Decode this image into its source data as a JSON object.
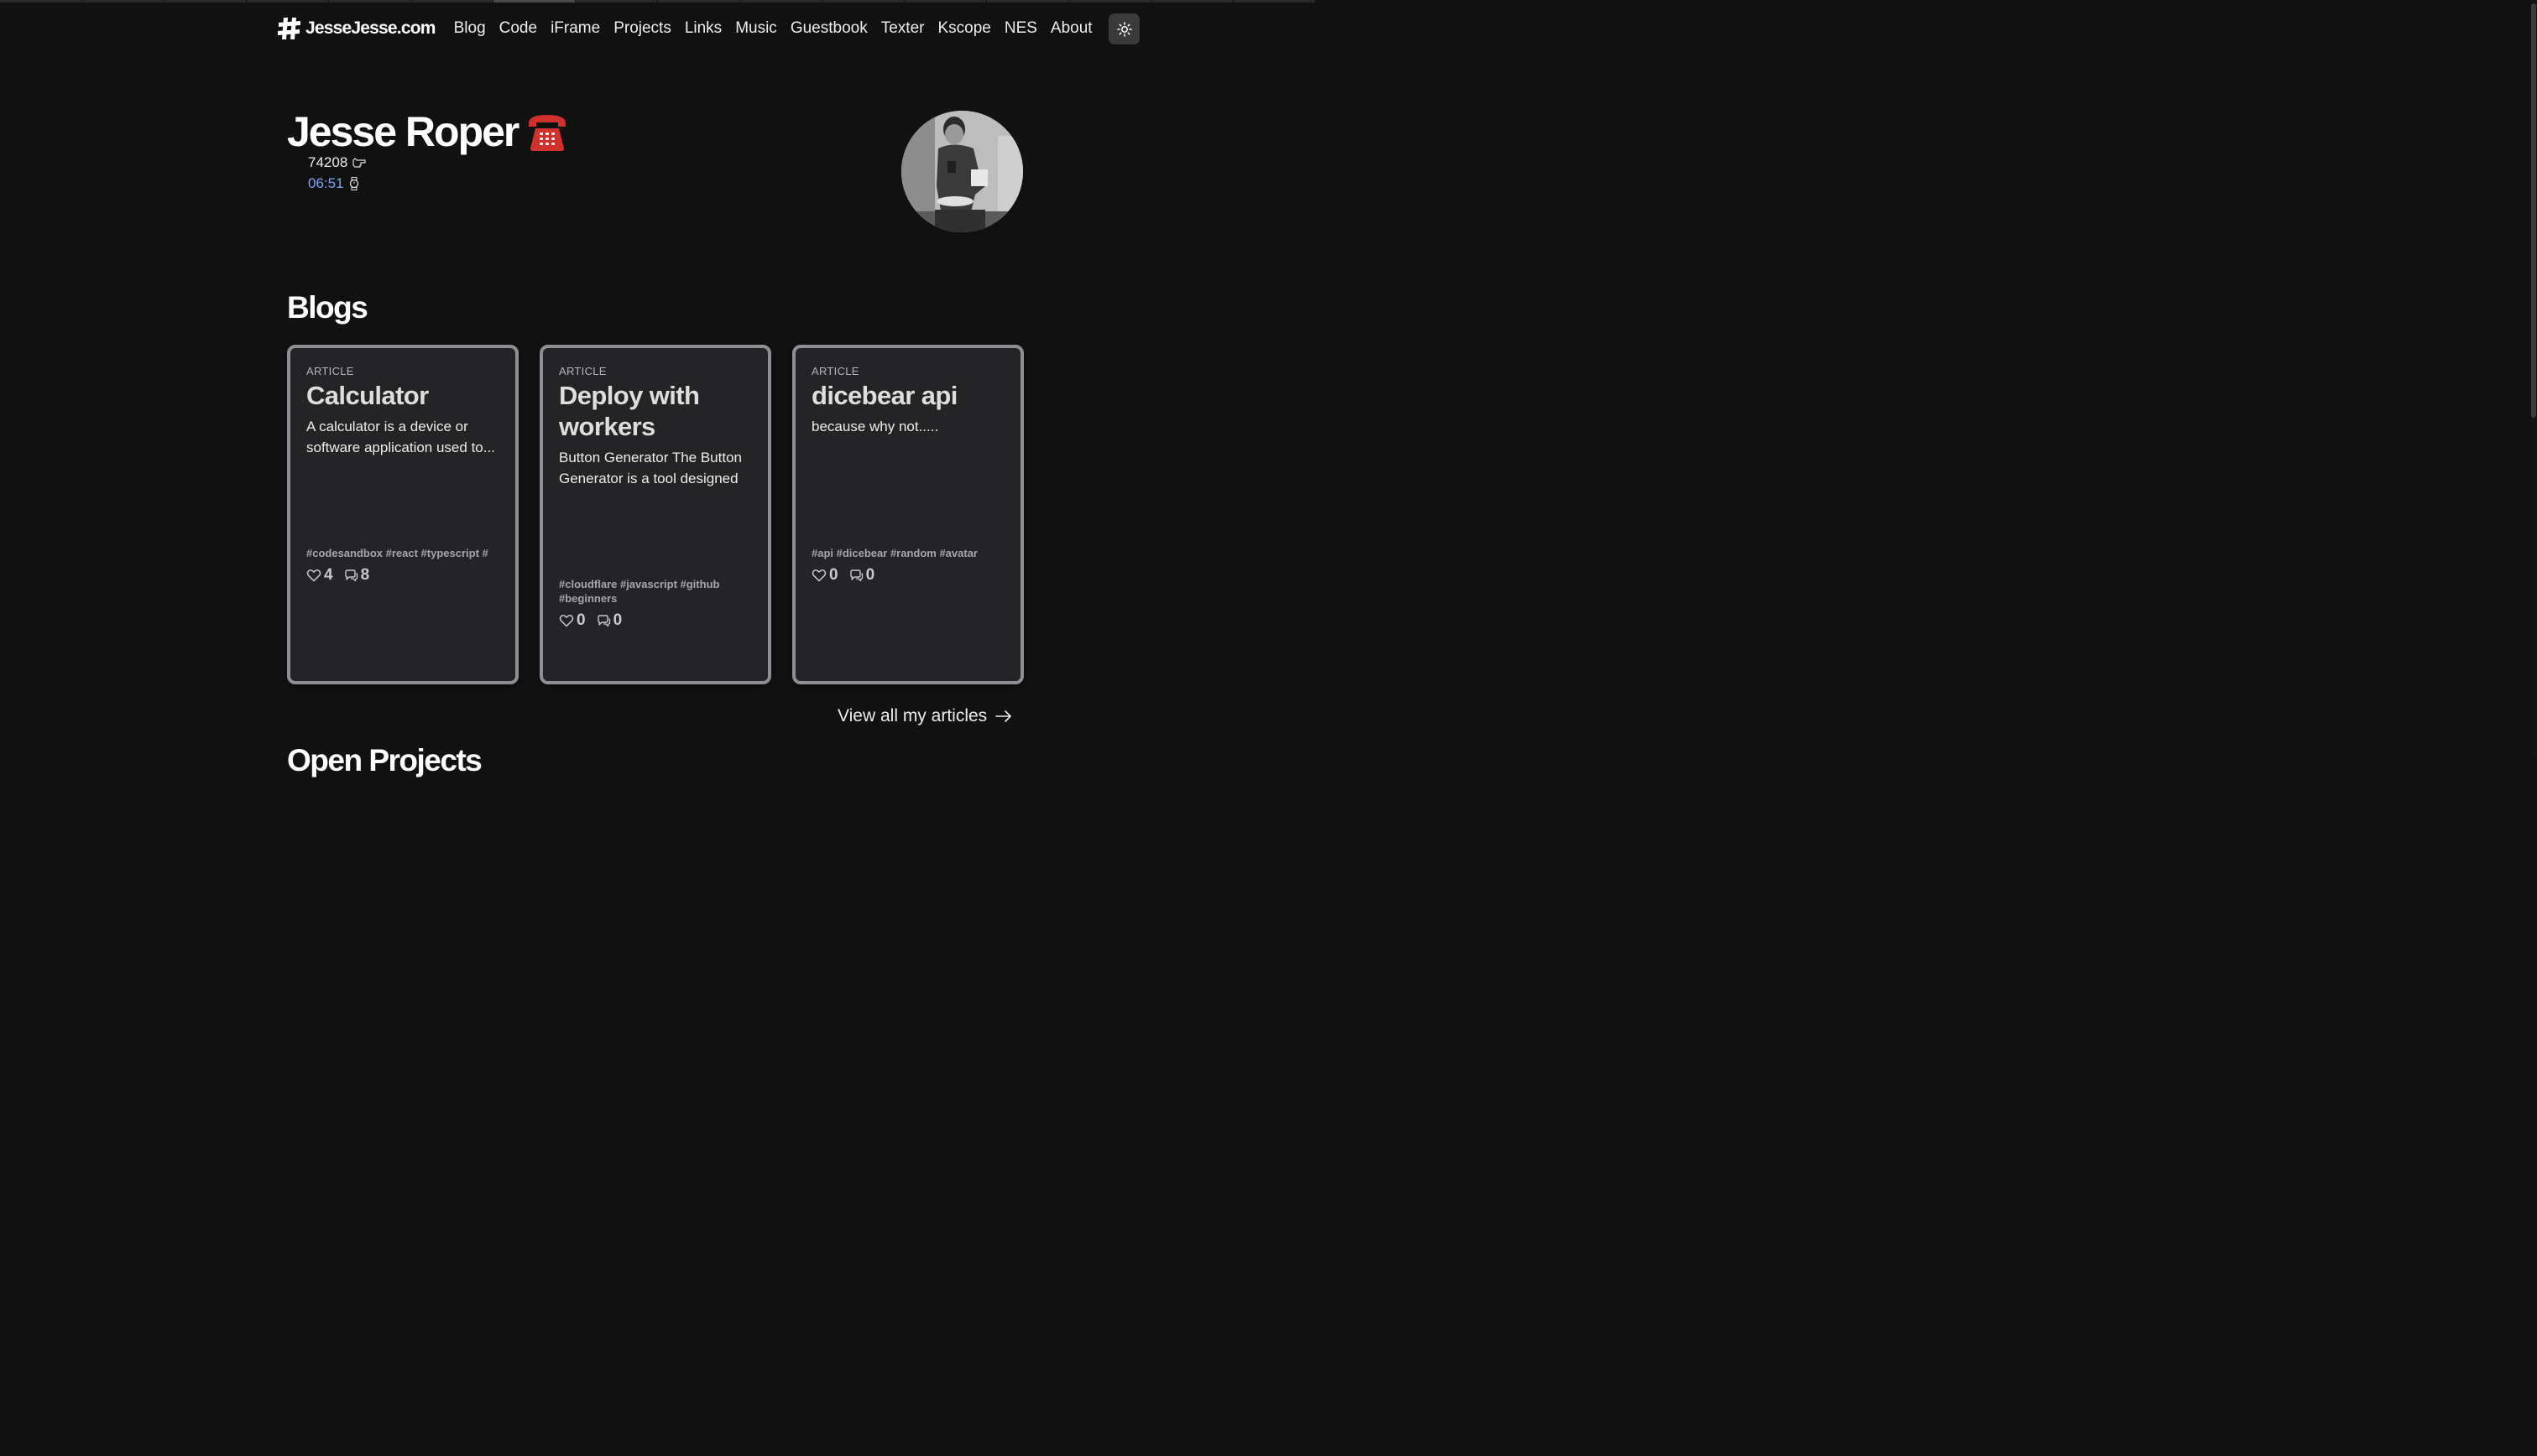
{
  "header": {
    "logo_text": "JesseJesse.com",
    "nav_links": [
      "Blog",
      "Code",
      "iFrame",
      "Projects",
      "Links",
      "Music",
      "Guestbook",
      "Texter",
      "Kscope",
      "NES",
      "About"
    ],
    "theme_toggle_icon": "sun-icon"
  },
  "hero": {
    "name": "Jesse Roper",
    "name_emoji_icon": "telephone-icon",
    "visit_count": "74208",
    "visit_icon": "pointing-hand-icon",
    "local_time": "06:51",
    "time_icon": "watch-icon",
    "avatar_icon": "profile-photo"
  },
  "blogs": {
    "title": "Blogs",
    "cards": [
      {
        "type": "ARTICLE",
        "title": "Calculator",
        "description": "A calculator is a device or software application used to...",
        "tags": "#codesandbox #react #typescript #",
        "likes": "4",
        "comments": "8"
      },
      {
        "type": "ARTICLE",
        "title": "Deploy with workers",
        "description": "Button Generator The Button Generator is a tool designed ...",
        "tags": "#cloudflare #javascript #github #beginners",
        "likes": "0",
        "comments": "0"
      },
      {
        "type": "ARTICLE",
        "title": "dicebear api",
        "description": "because why not.....",
        "tags": "#api #dicebear #random #avatar",
        "likes": "0",
        "comments": "0"
      }
    ],
    "view_all_label": "View all my articles"
  },
  "next_section": {
    "title": "Open Projects"
  },
  "colors": {
    "background": "#111112",
    "card_background": "#242427",
    "card_border": "#8e8e94",
    "time_accent": "#7ea6ee",
    "phone_red": "#d0312d"
  }
}
